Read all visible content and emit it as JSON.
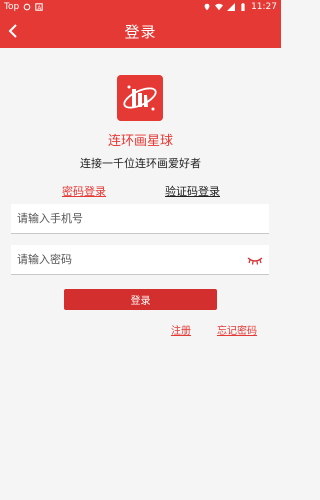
{
  "statusbar": {
    "carrier": "Top",
    "time": "11:27"
  },
  "appbar": {
    "title": "登录"
  },
  "app": {
    "name": "连环画星球",
    "slogan": "连接一千位连环画爱好者"
  },
  "tabs": {
    "password_login": "密码登录",
    "code_login": "验证码登录"
  },
  "form": {
    "phone_placeholder": "请输入手机号",
    "password_placeholder": "请输入密码",
    "login_label": "登录"
  },
  "links": {
    "register": "注册",
    "forgot": "忘记密码"
  },
  "colors": {
    "brand": "#e53935",
    "button": "#d32f2f",
    "background": "#f5f5f5"
  }
}
